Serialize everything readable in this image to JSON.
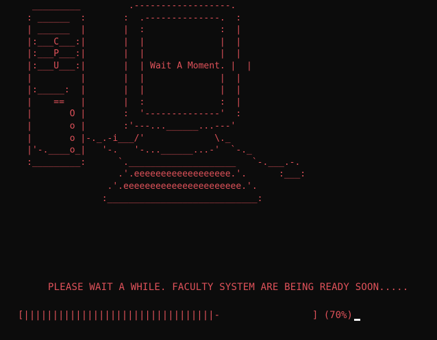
{
  "terminal": {
    "background": "#0c0c0c",
    "text_color": "#e0525a",
    "ascii_art": "      _________         .------------------.\n     : ______  :       :  .--------------.  :\n     | ______  |       |  :              :  |\n     |:___C___:|       |  |              |  |\n     |:___P___:|       |  |              |  |\n     |:___U___:|       |  | Wait A Moment. |  |\n     |         |       |  |              |  |\n     |:_____:  |       |  |              |  |\n     |    ==   |       |  :              :  |\n     |       O |       :  '--------------'  :\n     |       o |       :'---...______...---'\n     |       o |-._.-i___/'             \\._\n     |'-.____o_|   '-.   '-...______...-'  `-._\n     :_________:      `.____________________   `-.___.-.\n                      .'.eeeeeeeeeeeeeeeeee.'.      :___:\n                    .'.eeeeeeeeeeeeeeeeeeeeee.'.\n                   :____________________________:",
    "status_message": "PLEASE WAIT A WHILE. FACULTY SYSTEM ARE BEING READY SOON.....",
    "progress_bar": "[|||||||||||||||||||||||||||||||||-                ]",
    "progress_percent_text": "(70%)",
    "progress_fraction": 0.7
  }
}
